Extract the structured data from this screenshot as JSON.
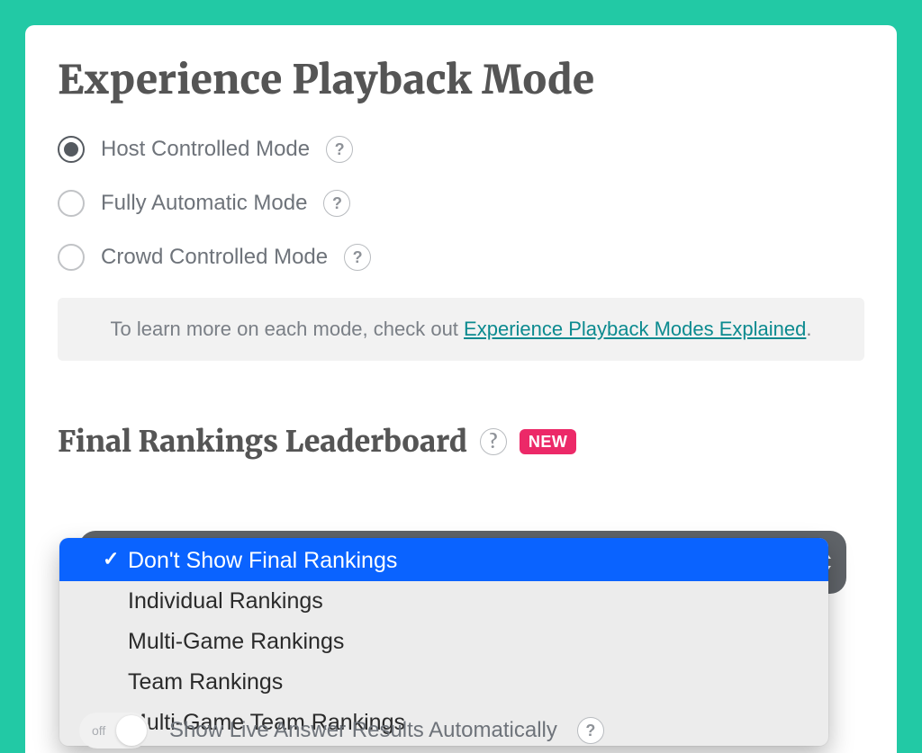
{
  "page_title": "Experience Playback Mode",
  "modes": [
    {
      "label": "Host Controlled Mode",
      "selected": true
    },
    {
      "label": "Fully Automatic Mode",
      "selected": false
    },
    {
      "label": "Crowd Controlled Mode",
      "selected": false
    }
  ],
  "info": {
    "prefix": "To learn more on each mode, check out ",
    "link_text": "Experience Playback Modes Explained",
    "suffix": "."
  },
  "section": {
    "title": "Final Rankings Leaderboard",
    "badge": "NEW"
  },
  "rankings_select": {
    "selected_index": 0,
    "options": [
      "Don't Show Final Rankings",
      "Individual Rankings",
      "Multi-Game Rankings",
      "Team Rankings",
      "Multi-Game Team Rankings"
    ]
  },
  "toggle": {
    "state_text": "off",
    "label": "Show Live Answer Results Automatically"
  },
  "help_glyph": "?"
}
